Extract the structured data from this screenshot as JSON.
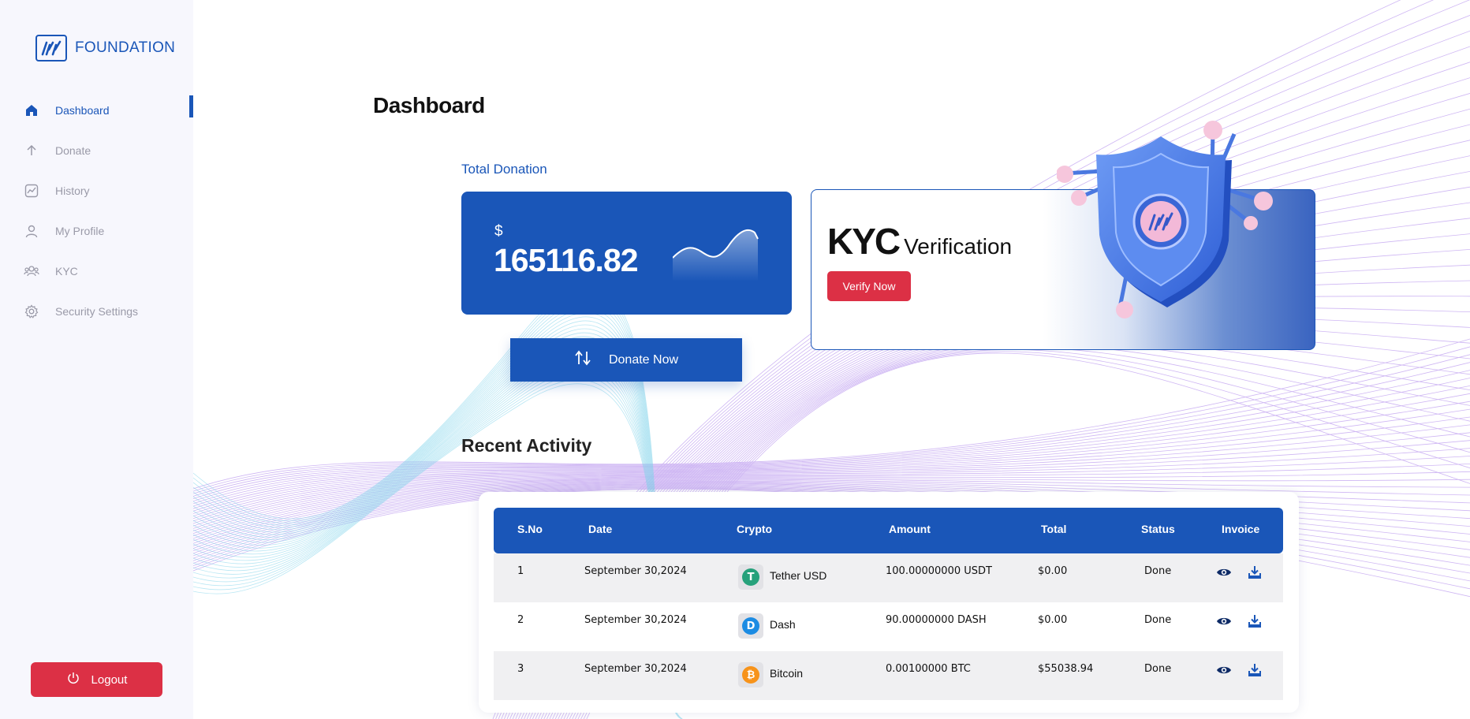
{
  "brand": {
    "name": "FOUNDATION"
  },
  "sidebar": {
    "items": [
      {
        "label": "Dashboard",
        "icon": "home-icon",
        "active": true
      },
      {
        "label": "Donate",
        "icon": "arrow-up-icon"
      },
      {
        "label": "History",
        "icon": "chart-icon"
      },
      {
        "label": "My Profile",
        "icon": "user-icon"
      },
      {
        "label": "KYC",
        "icon": "users-icon"
      },
      {
        "label": "Security Settings",
        "icon": "gear-icon"
      }
    ],
    "logout_label": "Logout"
  },
  "main": {
    "title": "Dashboard",
    "total": {
      "label": "Total Donation",
      "currency": "$",
      "amount": "165116.82"
    },
    "donate_button": "Donate Now",
    "kyc": {
      "title_big": "KYC",
      "title_small": "Verification",
      "button": "Verify Now"
    },
    "recent_title": "Recent Activity"
  },
  "table": {
    "headers": [
      "S.No",
      "Date",
      "Crypto",
      "Amount",
      "Total",
      "Status",
      "Invoice"
    ],
    "rows": [
      {
        "sno": "1",
        "date": "September 30,2024",
        "crypto": "Tether USD",
        "coin_icon": "tether-icon",
        "coin_color": "#26a17b",
        "amount": "100.00000000 USDT",
        "total": "$0.00",
        "status": "Done"
      },
      {
        "sno": "2",
        "date": "September 30,2024",
        "crypto": "Dash",
        "coin_icon": "dash-icon",
        "coin_color": "#1c8ce3",
        "amount": "90.00000000 DASH",
        "total": "$0.00",
        "status": "Done"
      },
      {
        "sno": "3",
        "date": "September 30,2024",
        "crypto": "Bitcoin",
        "coin_icon": "bitcoin-icon",
        "coin_color": "#f7931a",
        "amount": "0.00100000 BTC",
        "total": "$55038.94",
        "status": "Done"
      }
    ]
  },
  "colors": {
    "primary": "#1a56b8",
    "danger": "#dc3045",
    "sidebar_bg": "#f7f7fd"
  }
}
